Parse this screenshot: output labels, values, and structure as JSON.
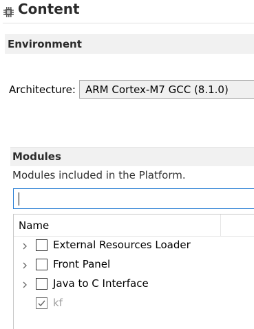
{
  "header": {
    "title": "Content",
    "icon": "chip-gear-icon"
  },
  "environment": {
    "section_title": "Environment",
    "architecture_label": "Architecture:",
    "architecture_value": "ARM Cortex-M7 GCC (8.1.0)"
  },
  "modules": {
    "section_title": "Modules",
    "description": "Modules included in the Platform.",
    "filter_value": "",
    "column_header": "Name",
    "items": [
      {
        "label": "External Resources Loader",
        "checked": false,
        "expandable": true,
        "enabled": true
      },
      {
        "label": "Front Panel",
        "checked": false,
        "expandable": true,
        "enabled": true
      },
      {
        "label": "Java to C Interface",
        "checked": false,
        "expandable": true,
        "enabled": true
      },
      {
        "label": "kf",
        "checked": true,
        "expandable": false,
        "enabled": false
      }
    ]
  },
  "colors": {
    "section_header_bg": "#f1f1f1",
    "focus_border": "#2a7fd4",
    "disabled_text": "#a0a0a0"
  }
}
